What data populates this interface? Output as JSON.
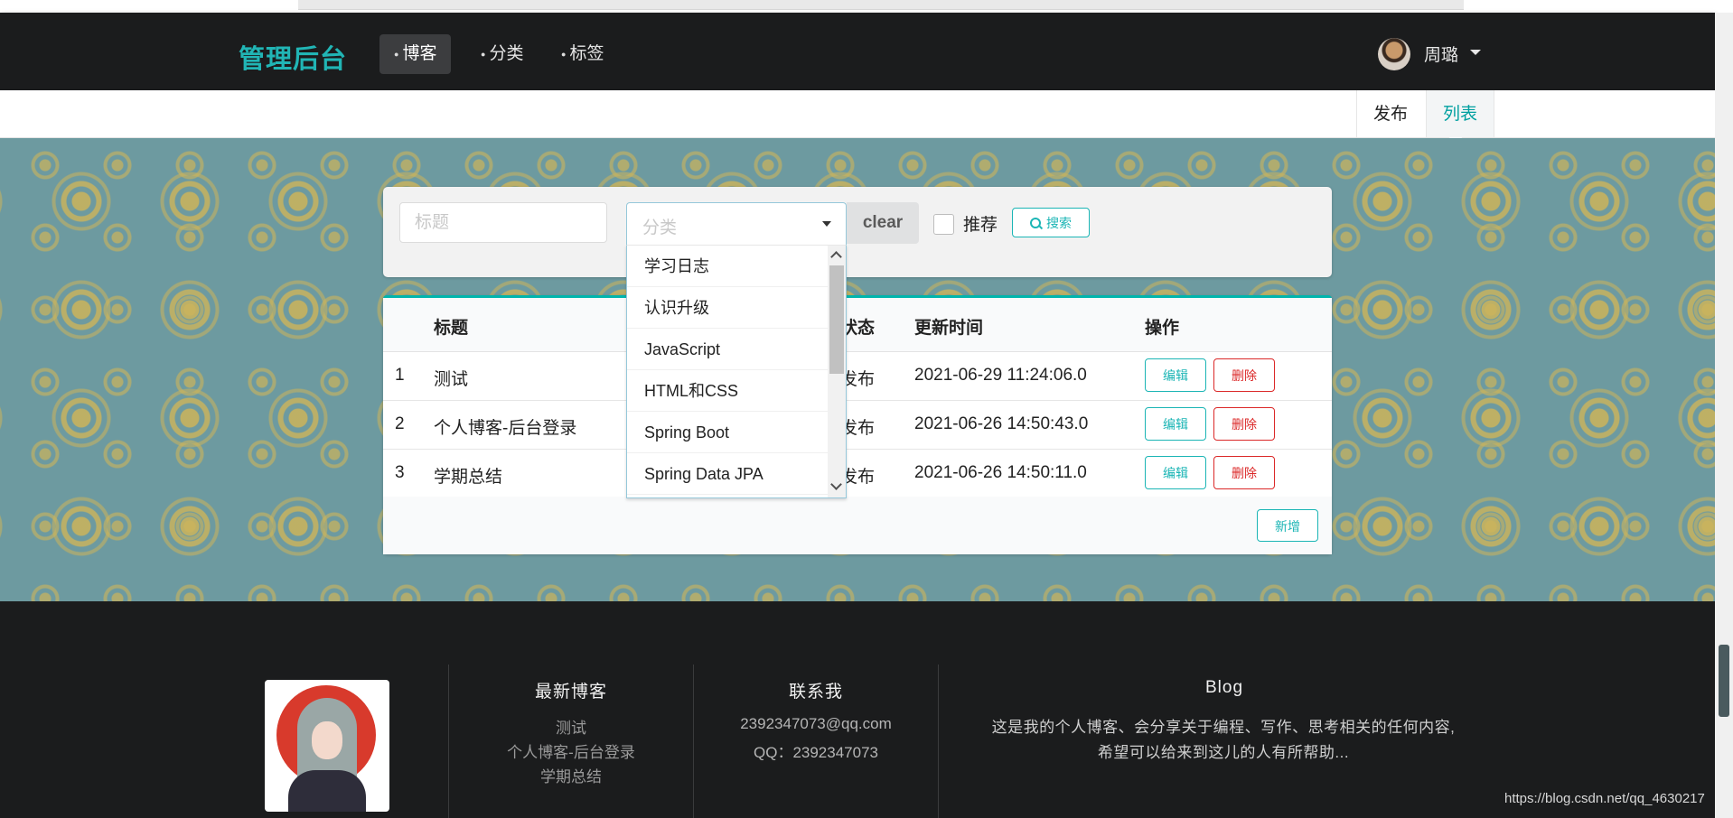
{
  "nav": {
    "brand": "管理后台",
    "items": [
      {
        "label": "博客",
        "icon": "dot-icon",
        "active": true
      },
      {
        "label": "分类",
        "icon": "dot-icon",
        "active": false
      },
      {
        "label": "标签",
        "icon": "dot-icon",
        "active": false
      }
    ],
    "user": "周璐"
  },
  "submenu": {
    "publish": "发布",
    "list": "列表",
    "active": "列表"
  },
  "search": {
    "title_placeholder": "标题",
    "category_placeholder": "分类",
    "clear_label": "clear",
    "recommend_label": "推荐",
    "recommend_checked": false,
    "search_label": "搜索"
  },
  "category_options": [
    "学习日志",
    "认识升级",
    "JavaScript",
    "HTML和CSS",
    "Spring Boot",
    "Spring Data JPA"
  ],
  "table": {
    "headers": {
      "title": "标题",
      "status": "状态",
      "updated": "更新时间",
      "actions": "操作"
    },
    "rows": [
      {
        "index": "1",
        "title": "测试",
        "status": "发布",
        "updated": "2021-06-29 11:24:06.0"
      },
      {
        "index": "2",
        "title": "个人博客-后台登录",
        "status": "发布",
        "updated": "2021-06-26 14:50:43.0"
      },
      {
        "index": "3",
        "title": "学期总结",
        "status": "发布",
        "updated": "2021-06-26 14:50:11.0"
      }
    ],
    "edit_label": "编辑",
    "delete_label": "删除",
    "add_label": "新增"
  },
  "footer": {
    "latest_title": "最新博客",
    "latest_links": [
      "测试",
      "个人博客-后台登录",
      "学期总结"
    ],
    "contact_title": "联系我",
    "contact_lines": [
      "2392347073@qq.com",
      "QQ：2392347073"
    ],
    "blog_title": "Blog",
    "blog_desc_1": "这是我的个人博客、会分享关于编程、写作、思考相关的任何内容,",
    "blog_desc_2": "希望可以给来到这儿的人有所帮助...",
    "watermark": "https://blog.csdn.net/qq_4630217"
  },
  "colors": {
    "accent": "#00b5ad",
    "danger": "#db2828",
    "nav_bg": "#1b1c1d"
  }
}
